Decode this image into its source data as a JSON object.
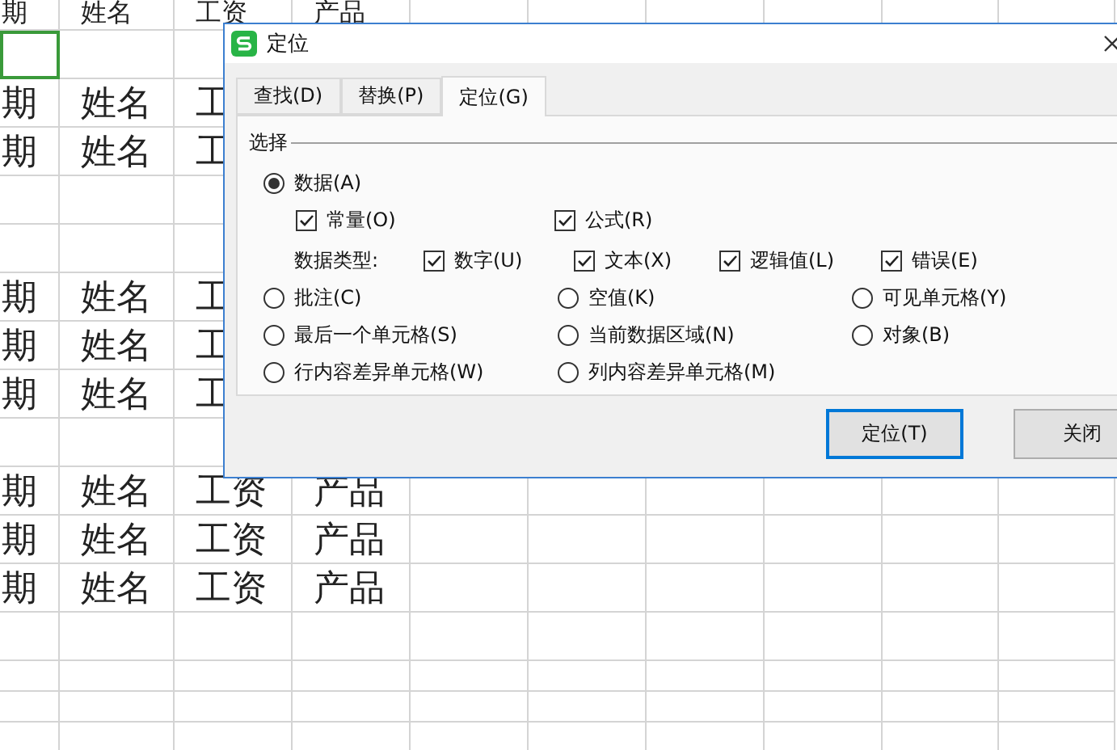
{
  "sheet": {
    "rows": [
      {
        "cells": [
          "期",
          "姓名",
          "工资",
          "产品"
        ],
        "active_first_cell": false
      },
      {
        "active_first_cell": true
      },
      {
        "cells": [
          "期",
          "姓名",
          "工"
        ],
        "active_first_cell": false
      },
      {
        "cells": [
          "期",
          "姓名",
          "工"
        ],
        "active_first_cell": false
      },
      {
        "active_first_cell": false
      },
      {
        "active_first_cell": false
      },
      {
        "cells": [
          "期",
          "姓名",
          "工"
        ],
        "active_first_cell": false
      },
      {
        "cells": [
          "期",
          "姓名",
          "工"
        ],
        "active_first_cell": false
      },
      {
        "cells": [
          "期",
          "姓名",
          "工"
        ],
        "active_first_cell": false
      },
      {
        "active_first_cell": false
      },
      {
        "cells": [
          "期",
          "姓名",
          "工资",
          "产品"
        ],
        "active_first_cell": false
      },
      {
        "cells": [
          "期",
          "姓名",
          "工资",
          "产品"
        ],
        "active_first_cell": false
      },
      {
        "cells": [
          "期",
          "姓名",
          "工资",
          "产品"
        ],
        "active_first_cell": false
      },
      {
        "active_first_cell": false
      },
      {
        "active_first_cell": false
      },
      {
        "active_first_cell": false
      },
      {
        "active_first_cell": false
      }
    ]
  },
  "dialog": {
    "title": "定位",
    "tabs": [
      {
        "label": "查找(D)",
        "selected": false
      },
      {
        "label": "替换(P)",
        "selected": false
      },
      {
        "label": "定位(G)",
        "selected": true
      }
    ],
    "group_label": "选择",
    "options": [
      {
        "label": "数据(A)",
        "selected": true
      },
      {
        "label": "批注(C)",
        "selected": false
      },
      {
        "label": "空值(K)",
        "selected": false
      },
      {
        "label": "可见单元格(Y)",
        "selected": false
      },
      {
        "label": "最后一个单元格(S)",
        "selected": false
      },
      {
        "label": "当前数据区域(N)",
        "selected": false
      },
      {
        "label": "对象(B)",
        "selected": false
      },
      {
        "label": "行内容差异单元格(W)",
        "selected": false
      },
      {
        "label": "列内容差异单元格(M)",
        "selected": false
      }
    ],
    "data_checks": [
      {
        "label": "常量(O)",
        "checked": true
      },
      {
        "label": "公式(R)",
        "checked": true
      }
    ],
    "type_label": "数据类型:",
    "types": [
      {
        "label": "数字(U)",
        "checked": true
      },
      {
        "label": "文本(X)",
        "checked": true
      },
      {
        "label": "逻辑值(L)",
        "checked": true
      },
      {
        "label": "错误(E)",
        "checked": true
      }
    ],
    "buttons": [
      {
        "label": "定位(T)",
        "default": true
      },
      {
        "label": "关闭",
        "default": false
      }
    ]
  }
}
